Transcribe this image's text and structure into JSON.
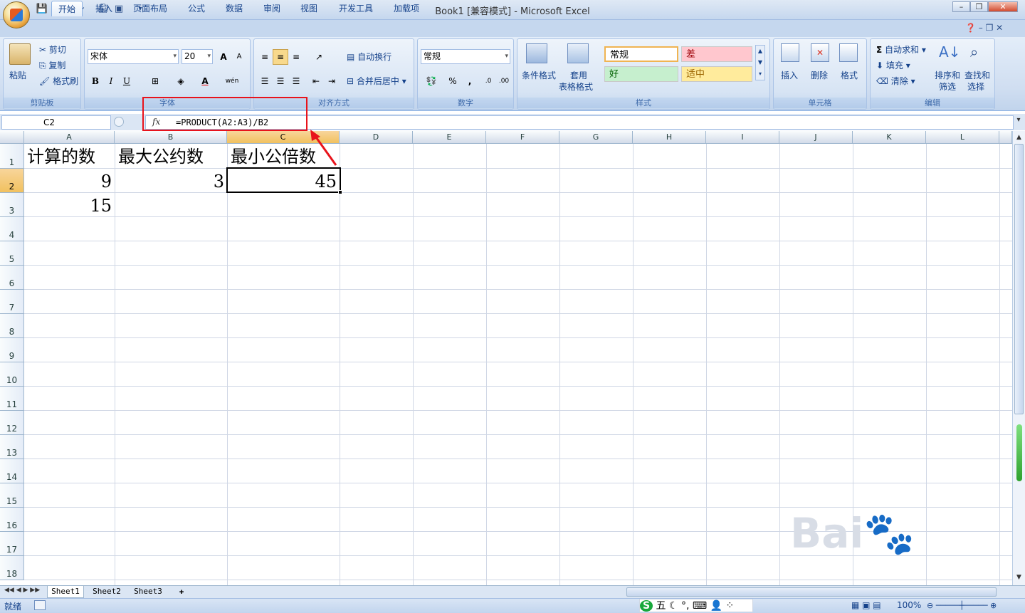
{
  "window": {
    "title": "Book1  [兼容模式] - Microsoft Excel"
  },
  "tabs": [
    "开始",
    "插入",
    "页面布局",
    "公式",
    "数据",
    "审阅",
    "视图",
    "开发工具",
    "加载项"
  ],
  "ribbon": {
    "clipboard": {
      "label": "剪贴板",
      "paste": "粘贴",
      "cut": "剪切",
      "copy": "复制",
      "format_painter": "格式刷"
    },
    "font": {
      "label": "字体",
      "font_name": "宋体",
      "font_size": "20",
      "bold": "B",
      "italic": "I",
      "underline": "U",
      "grow": "A",
      "shrink": "A",
      "font_color": "A",
      "wen": "wén"
    },
    "alignment": {
      "label": "对齐方式",
      "wrap": "自动换行",
      "merge": "合并后居中"
    },
    "number": {
      "label": "数字",
      "format": "常规",
      "percent": "%",
      "comma": ","
    },
    "styles": {
      "label": "样式",
      "conditional": "条件格式",
      "table_line1": "套用",
      "table_line2": "表格格式",
      "normal": "常规",
      "bad": "差",
      "good": "好",
      "neutral": "适中"
    },
    "cells": {
      "label": "单元格",
      "insert": "插入",
      "delete": "删除",
      "format": "格式"
    },
    "editing": {
      "label": "编辑",
      "autosum": "自动求和",
      "fill": "填充",
      "clear": "清除",
      "sort_line1": "排序和",
      "sort_line2": "筛选",
      "find_line1": "查找和",
      "find_line2": "选择"
    }
  },
  "formula_bar": {
    "name_box": "C2",
    "fx": "fx",
    "formula": "=PRODUCT(A2:A3)/B2"
  },
  "columns": [
    "A",
    "B",
    "C",
    "D",
    "E",
    "F",
    "G",
    "H",
    "I",
    "J",
    "K",
    "L"
  ],
  "rows": [
    "1",
    "2",
    "3",
    "4",
    "5",
    "6",
    "7",
    "8",
    "9",
    "10",
    "11",
    "12",
    "13",
    "14",
    "15",
    "16",
    "17",
    "18"
  ],
  "cells": {
    "A1": "计算的数",
    "B1": "最大公约数",
    "C1": "最小公倍数",
    "A2": "9",
    "B2": "3",
    "C2": "45",
    "A3": "15"
  },
  "sheets": [
    "Sheet1",
    "Sheet2",
    "Sheet3"
  ],
  "status": {
    "ready": "就绪",
    "zoom": "100%",
    "ime": "五"
  },
  "colors": {
    "highlight_red": "#e8131b",
    "ribbon_blue": "#15428b",
    "selected_header": "#f1c15f"
  }
}
